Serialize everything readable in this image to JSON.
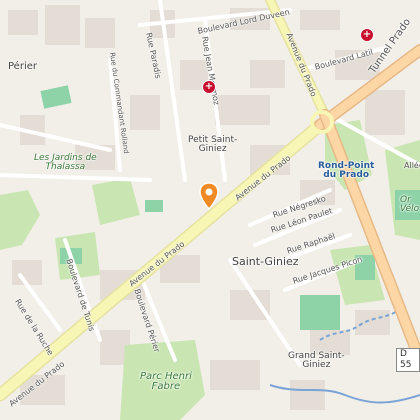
{
  "map": {
    "places": {
      "perier": "Périer",
      "petit_saint_giniez": "Petit Saint-\nGiniez",
      "saint_giniez": "Saint-Giniez",
      "grand_saint_giniez": "Grand Saint-\nGiniez",
      "rond_point": "Rond-Point\ndu Prado"
    },
    "parks": {
      "jardins": "Les Jardins de\nThalassa",
      "henri_fabre": "Parc Henri\nFabre",
      "velodrome": "Or\nVélo"
    },
    "streets": {
      "lord_duveen": "Boulevard Lord Duveen",
      "paradis": "Rue Paradis",
      "jean_mermoz": "Rue Jean Mermoz",
      "prado_vertical": "Avenue du Prado",
      "tunnel_prado": "Tunnel Prado",
      "latil": "Boulevard Latil",
      "commandant_rolland": "Rue du Commandant Rolland",
      "negresko": "Rue Négresko",
      "leon_paulet": "Rue Léon Paulet",
      "raphael": "Rue Raphaël",
      "jacques_picon": "Rue Jacques Picon",
      "boulevard_tunis": "Boulevard de Tunis",
      "rue_ruche": "Rue de la Ruche",
      "avenue_prado_lower": "Avenue du Prado",
      "avenue_prado_mid": "Avenue du Prado",
      "avenue_prado_upper": "Avenue du Prado",
      "boulevard_perier": "Boulevard Périer",
      "allee": "Allée"
    },
    "road_shield": "D 55",
    "pois": {
      "hospital_a": "+",
      "hospital_b": "+"
    },
    "colors": {
      "background": "#f2efe9",
      "avenue": "#f7f6b5",
      "tunnel_road": "#fcd6a4",
      "park": "#c9e6b2",
      "pitch": "#8ed3a8",
      "marker": "#f08a24",
      "hospital": "#c8102e"
    }
  }
}
